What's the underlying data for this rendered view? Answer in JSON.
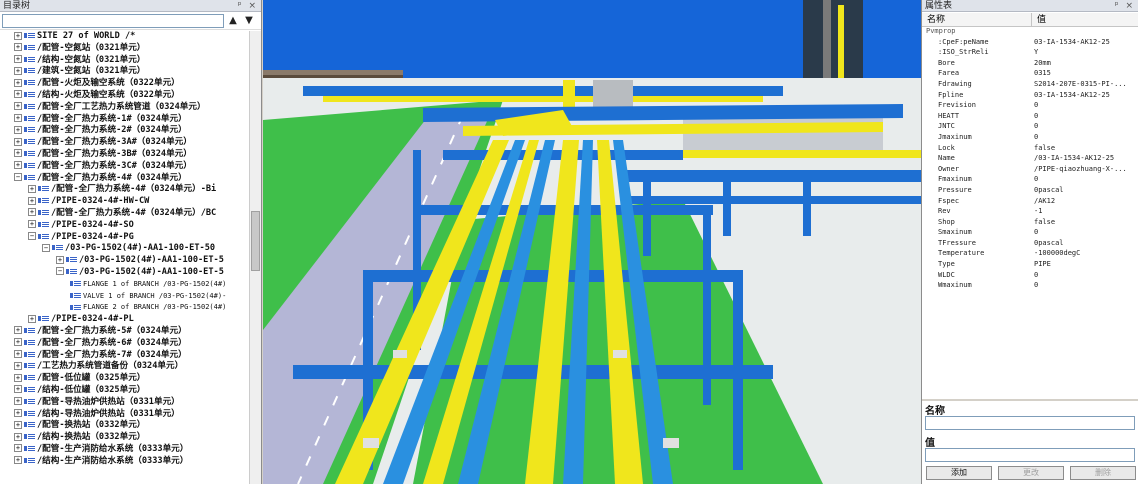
{
  "tree_panel": {
    "title": "目录树",
    "controls": "ᵖ ×",
    "search": {
      "value": "",
      "placeholder": ""
    },
    "up_arrow": "▲",
    "down_arrow": "▼",
    "nodes": [
      {
        "indent": 0,
        "exp": "+",
        "text": "SITE 27 of WORLD /*"
      },
      {
        "indent": 0,
        "exp": "+",
        "text": "/配管-空氮站（0321单元）"
      },
      {
        "indent": 0,
        "exp": "+",
        "text": "/结构-空氮站（0321单元）"
      },
      {
        "indent": 0,
        "exp": "+",
        "text": "/建筑-空氮站（0321单元）"
      },
      {
        "indent": 0,
        "exp": "+",
        "text": "/配管-火炬及输空系统（0322单元）"
      },
      {
        "indent": 0,
        "exp": "+",
        "text": "/结构-火炬及输空系统（0322单元）"
      },
      {
        "indent": 0,
        "exp": "+",
        "text": "/配管-全厂工艺热力系统管道（0324单元）"
      },
      {
        "indent": 0,
        "exp": "+",
        "text": "/配管-全厂热力系统-1#（0324单元）"
      },
      {
        "indent": 0,
        "exp": "+",
        "text": "/配管-全厂热力系统-2#（0324单元）"
      },
      {
        "indent": 0,
        "exp": "+",
        "text": "/配管-全厂热力系统-3A#（0324单元）"
      },
      {
        "indent": 0,
        "exp": "+",
        "text": "/配管-全厂热力系统-3B#（0324单元）"
      },
      {
        "indent": 0,
        "exp": "+",
        "text": "/配管-全厂热力系统-3C#（0324单元）"
      },
      {
        "indent": 0,
        "exp": "−",
        "text": "/配管-全厂热力系统-4#（0324单元）"
      },
      {
        "indent": 1,
        "exp": "+",
        "text": "/配管-全厂热力系统-4#（0324单元）-Bi"
      },
      {
        "indent": 1,
        "exp": "+",
        "text": "/PIPE-0324-4#-HW-CW"
      },
      {
        "indent": 1,
        "exp": "+",
        "text": "/配管-全厂热力系统-4#（0324单元）/BC"
      },
      {
        "indent": 1,
        "exp": "+",
        "text": "/PIPE-0324-4#-SO"
      },
      {
        "indent": 1,
        "exp": "−",
        "text": "/PIPE-0324-4#-PG"
      },
      {
        "indent": 2,
        "exp": "−",
        "text": "/03-PG-1502(4#)-AA1-100-ET-50"
      },
      {
        "indent": 3,
        "exp": "+",
        "text": "/03-PG-1502(4#)-AA1-100-ET-5"
      },
      {
        "indent": 3,
        "exp": "−",
        "text": "/03-PG-1502(4#)-AA1-100-ET-5"
      },
      {
        "indent": 4,
        "exp": "",
        "small": true,
        "text": "FLANGE 1 of BRANCH /03-PG-1502(4#)"
      },
      {
        "indent": 4,
        "exp": "",
        "small": true,
        "text": "VALVE 1 of BRANCH /03-PG-1502(4#)-"
      },
      {
        "indent": 4,
        "exp": "",
        "small": true,
        "text": "FLANGE 2 of BRANCH /03-PG-1502(4#)"
      },
      {
        "indent": 1,
        "exp": "+",
        "text": "/PIPE-0324-4#-PL"
      },
      {
        "indent": 0,
        "exp": "+",
        "text": "/配管-全厂热力系统-5#（0324单元）"
      },
      {
        "indent": 0,
        "exp": "+",
        "text": "/配管-全厂热力系统-6#（0324单元）"
      },
      {
        "indent": 0,
        "exp": "+",
        "text": "/配管-全厂热力系统-7#（0324单元）"
      },
      {
        "indent": 0,
        "exp": "+",
        "text": "/工艺热力系统管道备份（0324单元）"
      },
      {
        "indent": 0,
        "exp": "+",
        "text": "/配管-低位罐（0325单元）"
      },
      {
        "indent": 0,
        "exp": "+",
        "text": "/结构-低位罐（0325单元）"
      },
      {
        "indent": 0,
        "exp": "+",
        "text": "/配管-导热油炉供热站（0331单元）"
      },
      {
        "indent": 0,
        "exp": "+",
        "text": "/结构-导热油炉供热站（0331单元）"
      },
      {
        "indent": 0,
        "exp": "+",
        "text": "/配管-换热站（0332单元）"
      },
      {
        "indent": 0,
        "exp": "+",
        "text": "/结构-换热站（0332单元）"
      },
      {
        "indent": 0,
        "exp": "+",
        "text": "/配管-生产消防给水系统（0333单元）"
      },
      {
        "indent": 0,
        "exp": "+",
        "text": "/结构-生产消防给水系统（0333单元）"
      }
    ]
  },
  "viewport": {
    "colors": {
      "sky": "#1565d8",
      "ground": "#e8ecec",
      "grass": "#3fbf4a",
      "road": "#b4b6d6",
      "yellow": "#f0e61c",
      "blue": "#1e6fd2",
      "pipe_blue": "#2a90e0"
    }
  },
  "props_panel": {
    "title": "属性表",
    "controls": "ᵖ ×",
    "col_name": "名称",
    "col_value": "值",
    "group": "Pvmprop",
    "rows": [
      {
        "k": ":CpeF:peName",
        "v": "03-IA-1534-AK12-25"
      },
      {
        "k": ":ISO_StrReli",
        "v": "Y"
      },
      {
        "k": "Bore",
        "v": "20mm"
      },
      {
        "k": "Farea",
        "v": "0315"
      },
      {
        "k": "Fdrawing",
        "v": "S2014-207E-0315-PI-..."
      },
      {
        "k": "Fpline",
        "v": "03-IA-1534-AK12-25"
      },
      {
        "k": "Frevision",
        "v": "0"
      },
      {
        "k": "HEATT",
        "v": "0"
      },
      {
        "k": "JNTC",
        "v": "0"
      },
      {
        "k": "Jmaxinum",
        "v": "0"
      },
      {
        "k": "Lock",
        "v": "false"
      },
      {
        "k": "Name",
        "v": "/03-IA-1534-AK12-25"
      },
      {
        "k": "Owner",
        "v": "/PIPE-qiaozhuang-X-..."
      },
      {
        "k": "Fmaxinum",
        "v": "0"
      },
      {
        "k": "Pressure",
        "v": "0pascal"
      },
      {
        "k": "Fspec",
        "v": "/AK12"
      },
      {
        "k": "Rev",
        "v": "-1"
      },
      {
        "k": "Shop",
        "v": "false"
      },
      {
        "k": "Smaxinum",
        "v": "0"
      },
      {
        "k": "TFressure",
        "v": "0pascal"
      },
      {
        "k": "Temperature",
        "v": "-100000degC"
      },
      {
        "k": "Type",
        "v": "PIPE"
      },
      {
        "k": "WLDC",
        "v": "0"
      },
      {
        "k": "Wmaxinum",
        "v": "0"
      }
    ],
    "name_label": "名称",
    "name_value": "",
    "value_label": "值",
    "value_value": "",
    "add_button": "添加",
    "modify_button": "更改",
    "delete_button": "删除"
  }
}
